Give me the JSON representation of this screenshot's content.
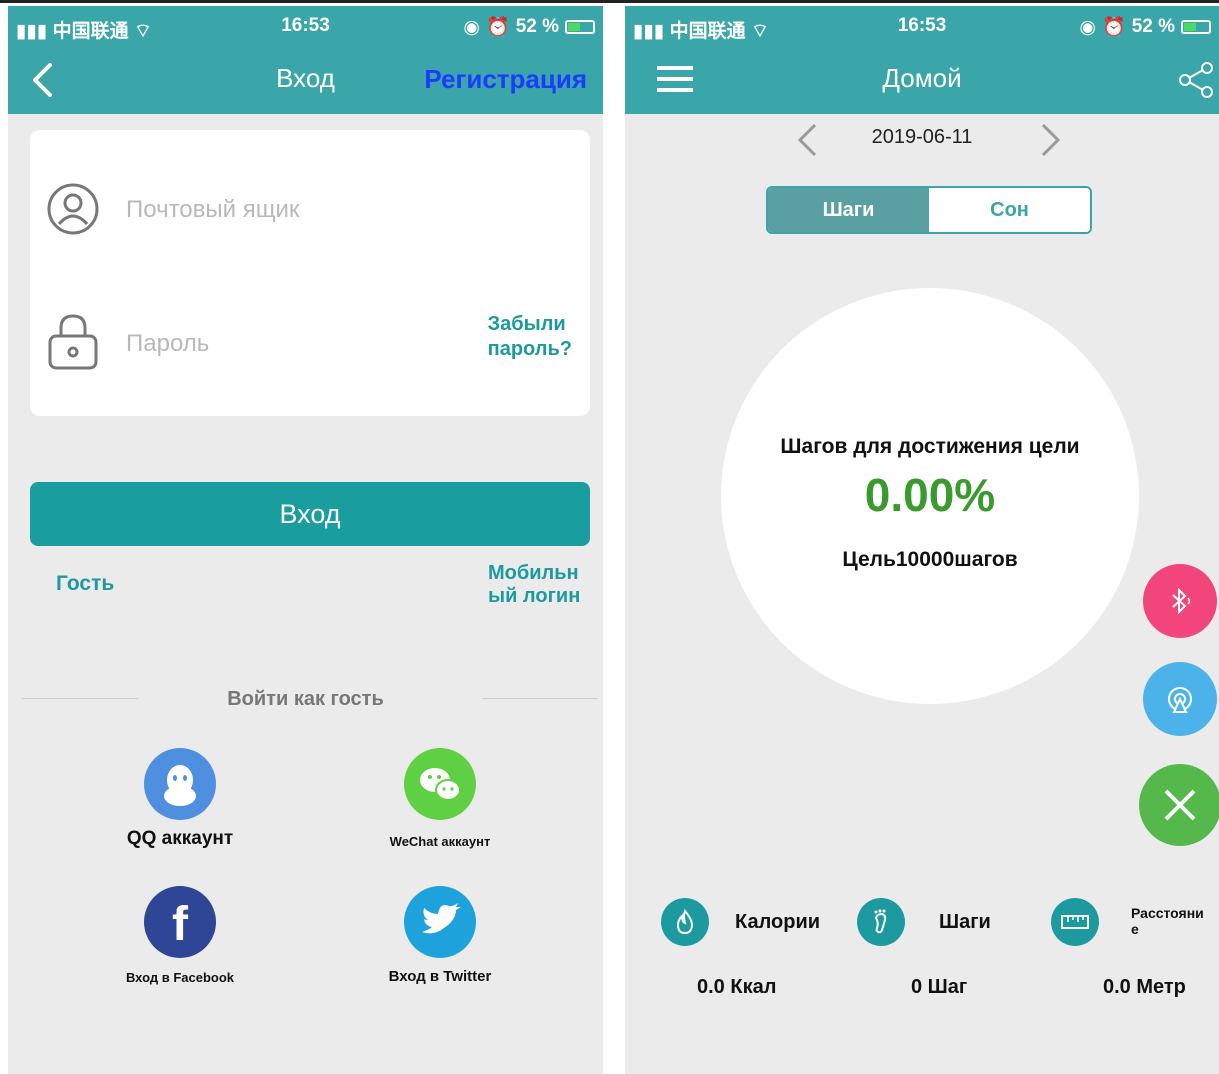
{
  "status": {
    "carrier": "中国联通",
    "time": "16:53",
    "battery": "52 %",
    "battery_level": 0.52
  },
  "login": {
    "title": "Вход",
    "register": "Регистрация",
    "email_placeholder": "Почтовый ящик",
    "password_placeholder": "Пароль",
    "forgot_line1": "Забыли",
    "forgot_line2": "пароль?",
    "login_button": "Вход",
    "guest": "Гость",
    "mobile_line1": "Мобильн",
    "mobile_line2": "ый логин",
    "divider": "Войти как гость",
    "qq": "QQ аккаунт",
    "wechat": "WeChat аккаунт",
    "facebook": "Вход в Facebook",
    "twitter": "Вход в Twitter"
  },
  "home": {
    "title": "Домой",
    "date": "2019-06-11",
    "tab_steps": "Шаги",
    "tab_sleep": "Сон",
    "goal_label": "Шагов для достижения цели",
    "percent": "0.00%",
    "goal": "Цель10000шагов",
    "calories_label": "Калории",
    "steps_label": "Шаги",
    "distance_line1": "Расстояни",
    "distance_line2": "е",
    "calories_value": "0.0 Ккал",
    "steps_value": "0 Шаг",
    "distance_value": "0.0 Метр"
  },
  "colors": {
    "teal": "#3aa6a9",
    "button": "#1a9d9f",
    "green": "#3b9a2e",
    "pink": "#f2457b",
    "blue": "#4bb3ea",
    "fab_green": "#55b84a"
  }
}
